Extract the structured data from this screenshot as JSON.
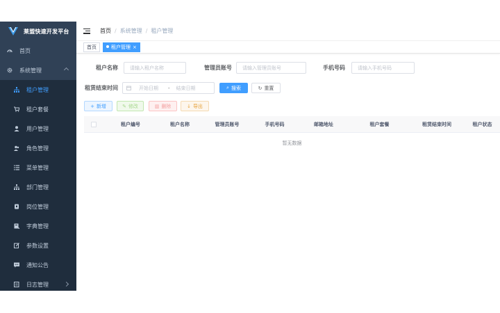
{
  "app": {
    "title": "莱盟快速开发平台"
  },
  "sidebar": {
    "home": "首页",
    "system": "系统管理",
    "items": [
      {
        "label": "租户管理",
        "icon": "tenant-icon",
        "active": true
      },
      {
        "label": "租户套餐",
        "icon": "cart-icon"
      },
      {
        "label": "用户管理",
        "icon": "user-icon"
      },
      {
        "label": "角色管理",
        "icon": "role-icon"
      },
      {
        "label": "菜单管理",
        "icon": "menu-icon"
      },
      {
        "label": "部门管理",
        "icon": "dept-icon"
      },
      {
        "label": "岗位管理",
        "icon": "post-icon"
      },
      {
        "label": "字典管理",
        "icon": "dict-icon"
      },
      {
        "label": "参数设置",
        "icon": "edit-icon"
      },
      {
        "label": "通知公告",
        "icon": "message-icon"
      },
      {
        "label": "日志管理",
        "icon": "log-icon"
      }
    ]
  },
  "breadcrumb": [
    "首页",
    "系统管理",
    "租户管理"
  ],
  "tags": [
    {
      "label": "首页",
      "active": false
    },
    {
      "label": "租户管理",
      "active": true
    }
  ],
  "search": {
    "tenant_name_label": "租户名称",
    "tenant_name_placeholder": "请输入租户名称",
    "admin_label": "管理员账号",
    "admin_placeholder": "请输入管理员账号",
    "phone_label": "手机号码",
    "phone_placeholder": "请输入手机号码",
    "expire_label": "租赁结束时间",
    "start_placeholder": "开始日期",
    "range_sep": "-",
    "end_placeholder": "结束日期",
    "search_btn": "搜索",
    "reset_btn": "重置"
  },
  "toolbar": {
    "add": "新增",
    "edit": "修改",
    "delete": "删除",
    "export": "导出"
  },
  "table": {
    "columns": [
      "租户编号",
      "租户名称",
      "管理员账号",
      "手机号码",
      "邮箱地址",
      "租户套餐",
      "租赁结束时间",
      "租户状态"
    ],
    "empty": "暂无数据"
  },
  "colors": {
    "sidebar_bg": "#304156",
    "accent": "#409eff"
  }
}
